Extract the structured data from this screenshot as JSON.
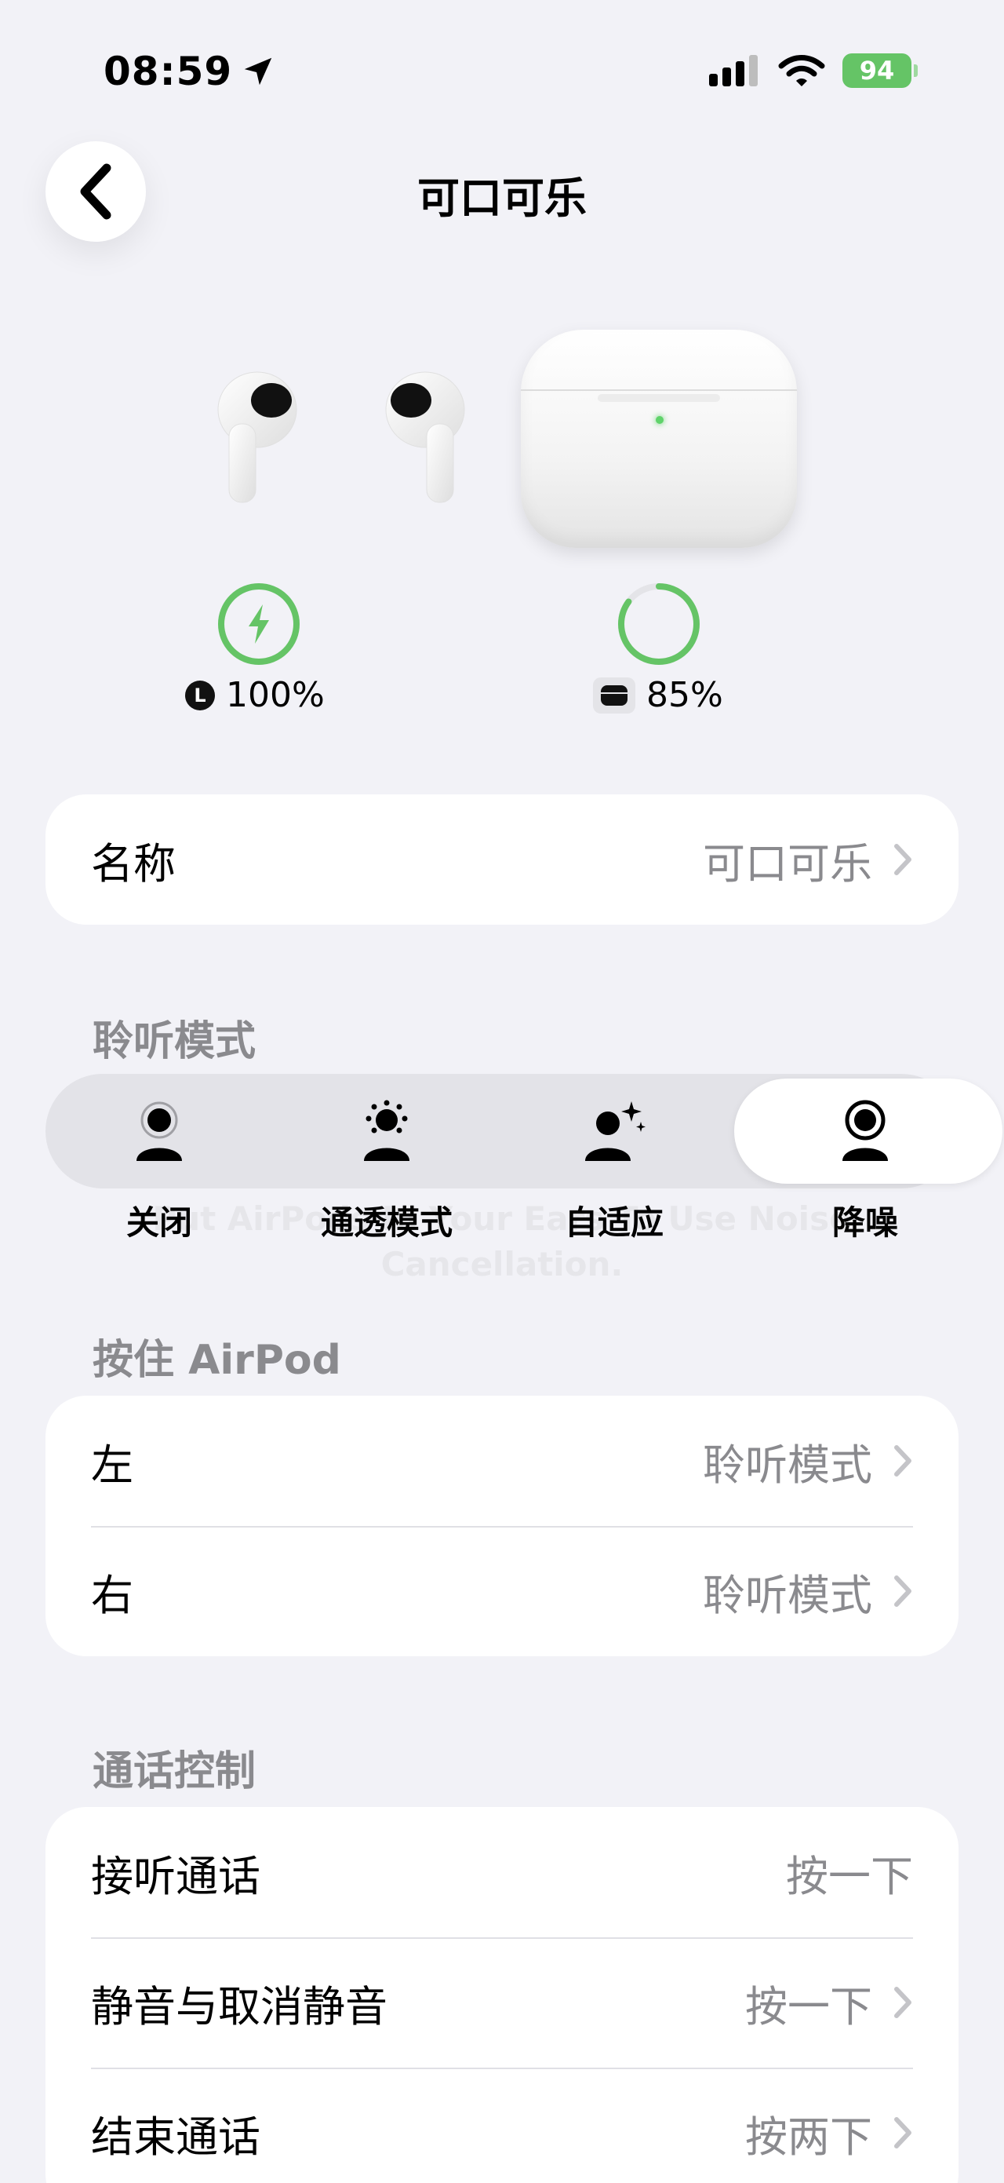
{
  "status_bar": {
    "time": "08:59",
    "battery_level": "94"
  },
  "header": {
    "title": "可口可乐"
  },
  "battery": {
    "buds_badge": "L",
    "buds_level": "100%",
    "buds_fraction": 1.0,
    "case_level": "85%",
    "case_fraction": 0.85,
    "ring_color": "#65c466"
  },
  "name_row": {
    "label": "名称",
    "value": "可口可乐"
  },
  "listening_mode": {
    "section_title": "聆听模式",
    "options": [
      {
        "label": "关闭"
      },
      {
        "label": "通透模式"
      },
      {
        "label": "自适应"
      },
      {
        "label": "降噪"
      }
    ],
    "selected": "降噪",
    "ghost_text": "Put AirPods In Your Ears To Use Noise Cancellation."
  },
  "hold_airpod": {
    "section_title": "按住 AirPod",
    "rows": [
      {
        "label": "左",
        "value": "聆听模式"
      },
      {
        "label": "右",
        "value": "聆听模式"
      }
    ]
  },
  "call_controls": {
    "section_title": "通话控制",
    "rows": [
      {
        "label": "接听通话",
        "value": "按一下"
      },
      {
        "label": "静音与取消静音",
        "value": "按一下"
      },
      {
        "label": "结束通话",
        "value": "按两下"
      }
    ]
  }
}
